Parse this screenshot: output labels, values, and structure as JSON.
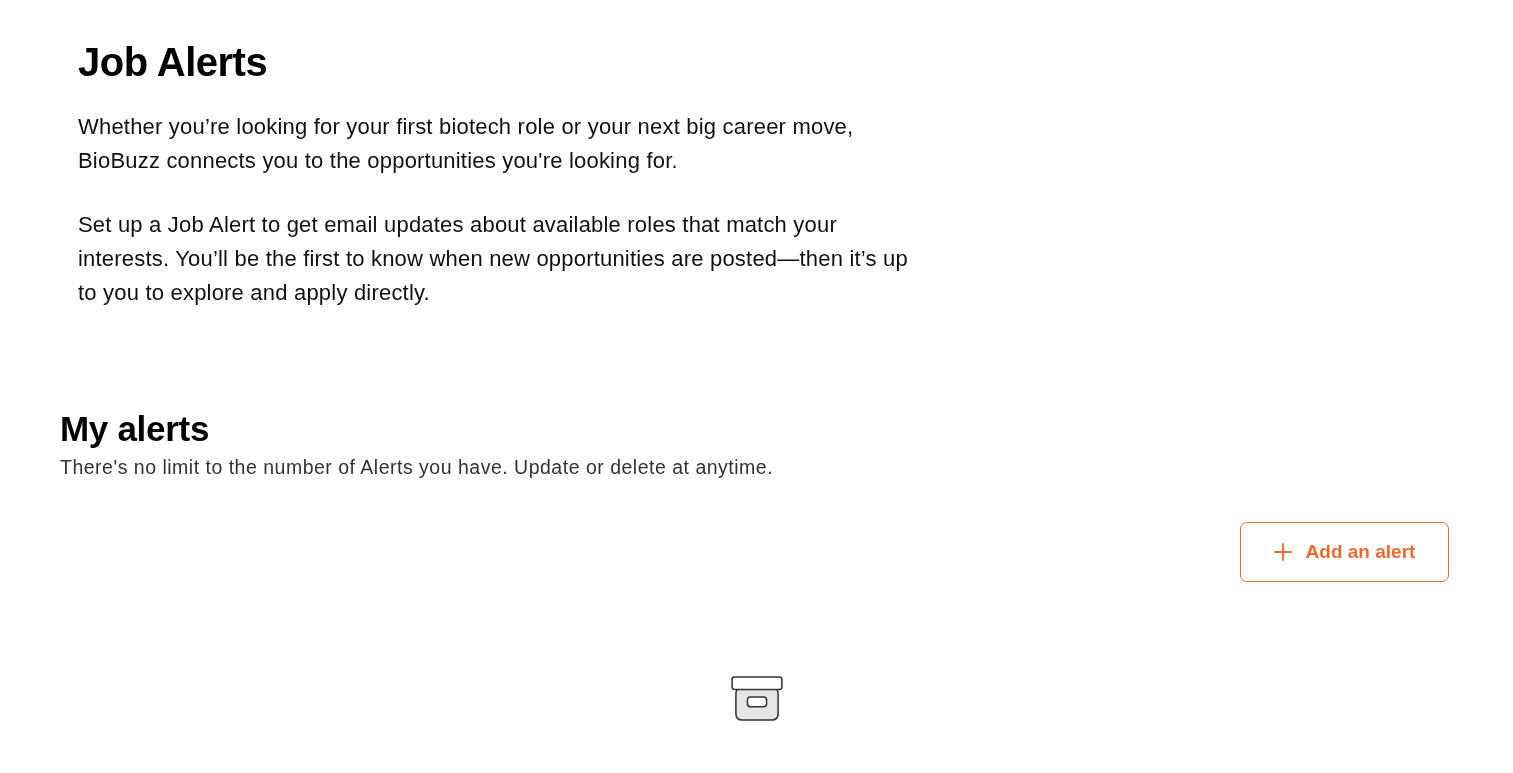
{
  "header": {
    "title": "Job Alerts",
    "paragraphs": [
      "Whether you’re looking for your first biotech role or your next big career move, BioBuzz connects you to the opportunities you're looking for.",
      "Set up a Job Alert to get email updates about available roles that match your interests. You’ll be the first to know when new opportunities are posted—then it’s up to you to explore and apply directly."
    ]
  },
  "alerts": {
    "title": "My alerts",
    "subtitle": "There's no limit to the number of Alerts you have. Update or delete at anytime.",
    "add_button": {
      "label": "Add an alert"
    }
  }
}
